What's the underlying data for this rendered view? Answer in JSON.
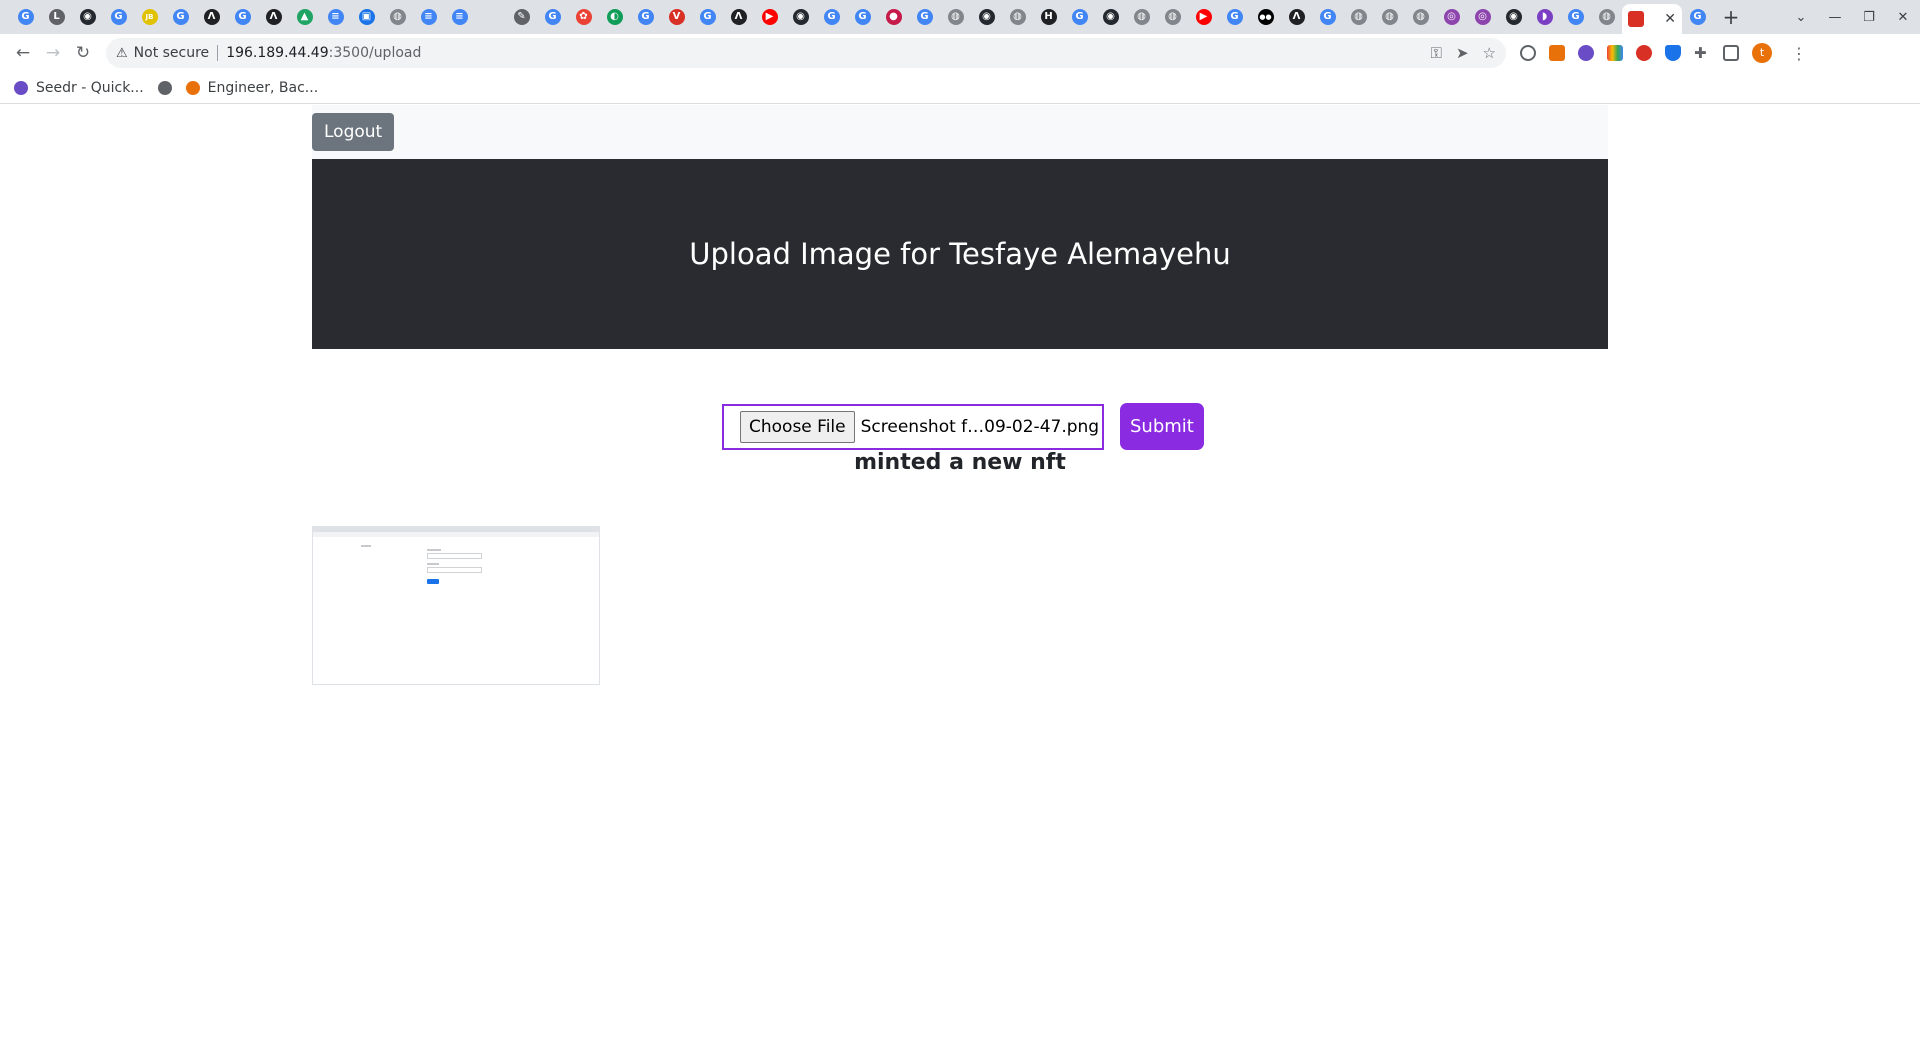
{
  "browser": {
    "url_security": "Not secure",
    "url_host": "196.189.44.49",
    "url_path": ":3500/upload",
    "tab_favicons": [
      {
        "icon": "google-icon",
        "color": "#4285f4",
        "glyph": "G"
      },
      {
        "icon": "letters-icon",
        "color": "#5f6368",
        "glyph": "L"
      },
      {
        "icon": "github-icon",
        "color": "#24292f",
        "glyph": "◉"
      },
      {
        "icon": "google-icon",
        "color": "#4285f4",
        "glyph": "G"
      },
      {
        "icon": "jb-icon",
        "color": "#e0c200",
        "glyph": "JB"
      },
      {
        "icon": "google-icon",
        "color": "#4285f4",
        "glyph": "G"
      },
      {
        "icon": "a-logo-icon",
        "color": "#202124",
        "glyph": "Λ"
      },
      {
        "icon": "google-icon",
        "color": "#4285f4",
        "glyph": "G"
      },
      {
        "icon": "a-logo-icon",
        "color": "#202124",
        "glyph": "Λ"
      },
      {
        "icon": "drive-icon",
        "color": "#1fa463",
        "glyph": "▲"
      },
      {
        "icon": "docs-icon",
        "color": "#4285f4",
        "glyph": "≡"
      },
      {
        "icon": "contacts-icon",
        "color": "#1a73e8",
        "glyph": "▣"
      },
      {
        "icon": "globe-icon",
        "color": "#80868b",
        "glyph": "◍"
      },
      {
        "icon": "docs-icon",
        "color": "#4285f4",
        "glyph": "≡"
      },
      {
        "icon": "docs-icon",
        "color": "#4285f4",
        "glyph": "≡"
      },
      {
        "icon": "blank-icon",
        "color": "#dee1e6",
        "glyph": ""
      },
      {
        "icon": "pen-icon",
        "color": "#5f6368",
        "glyph": "✎"
      },
      {
        "icon": "google-icon",
        "color": "#4285f4",
        "glyph": "G"
      },
      {
        "icon": "colorwheel-icon",
        "color": "#ea4335",
        "glyph": "✿"
      },
      {
        "icon": "edge-icon",
        "color": "#0f9d58",
        "glyph": "◐"
      },
      {
        "icon": "google-icon",
        "color": "#4285f4",
        "glyph": "G"
      },
      {
        "icon": "vivaldi-icon",
        "color": "#d93025",
        "glyph": "V"
      },
      {
        "icon": "google-icon",
        "color": "#4285f4",
        "glyph": "G"
      },
      {
        "icon": "a-logo-icon",
        "color": "#202124",
        "glyph": "Λ"
      },
      {
        "icon": "youtube-icon",
        "color": "#ff0000",
        "glyph": "▶"
      },
      {
        "icon": "github-icon",
        "color": "#24292f",
        "glyph": "◉"
      },
      {
        "icon": "google-icon",
        "color": "#4285f4",
        "glyph": "G"
      },
      {
        "icon": "google-icon",
        "color": "#4285f4",
        "glyph": "G"
      },
      {
        "icon": "raspberry-icon",
        "color": "#c51a4a",
        "glyph": "●"
      },
      {
        "icon": "google-icon",
        "color": "#4285f4",
        "glyph": "G"
      },
      {
        "icon": "globe-icon",
        "color": "#80868b",
        "glyph": "◍"
      },
      {
        "icon": "github-icon",
        "color": "#24292f",
        "glyph": "◉"
      },
      {
        "icon": "globe-icon",
        "color": "#80868b",
        "glyph": "◍"
      },
      {
        "icon": "hashnode-icon",
        "color": "#202124",
        "glyph": "H"
      },
      {
        "icon": "google-icon",
        "color": "#4285f4",
        "glyph": "G"
      },
      {
        "icon": "github-icon",
        "color": "#24292f",
        "glyph": "◉"
      },
      {
        "icon": "globe-icon",
        "color": "#80868b",
        "glyph": "◍"
      },
      {
        "icon": "globe-icon",
        "color": "#80868b",
        "glyph": "◍"
      },
      {
        "icon": "youtube-icon",
        "color": "#ff0000",
        "glyph": "▶"
      },
      {
        "icon": "google-icon",
        "color": "#4285f4",
        "glyph": "G"
      },
      {
        "icon": "medium-icon",
        "color": "#000000",
        "glyph": "●●"
      },
      {
        "icon": "a-logo-icon",
        "color": "#202124",
        "glyph": "Λ"
      },
      {
        "icon": "google-icon",
        "color": "#4285f4",
        "glyph": "G"
      },
      {
        "icon": "globe-icon",
        "color": "#80868b",
        "glyph": "◍"
      },
      {
        "icon": "globe-icon",
        "color": "#80868b",
        "glyph": "◍"
      },
      {
        "icon": "globe-icon",
        "color": "#80868b",
        "glyph": "◍"
      },
      {
        "icon": "ring-icon",
        "color": "#8e44ad",
        "glyph": "◎"
      },
      {
        "icon": "ring-icon",
        "color": "#8e44ad",
        "glyph": "◎"
      },
      {
        "icon": "github-icon",
        "color": "#24292f",
        "glyph": "◉"
      },
      {
        "icon": "firefox-icon",
        "color": "#7b3fc4",
        "glyph": "◗"
      },
      {
        "icon": "google-icon",
        "color": "#4285f4",
        "glyph": "G"
      },
      {
        "icon": "globe-icon",
        "color": "#80868b",
        "glyph": "◍"
      }
    ],
    "active_tab_favicon": {
      "icon": "upload-page-icon",
      "color": "#d93025"
    },
    "after_active_favicon": {
      "icon": "google-icon",
      "color": "#4285f4",
      "glyph": "G"
    },
    "bookmarks": [
      {
        "label": "Seedr - Quick...",
        "icon": "seedr-icon",
        "color": "#6a4cc7"
      },
      {
        "label": "",
        "icon": "globe-icon",
        "color": "#5f6368"
      },
      {
        "label": "Engineer, Bac...",
        "icon": "asterisk-icon",
        "color": "#e8710a"
      }
    ],
    "profile_initial": "t"
  },
  "page": {
    "logout_label": "Logout",
    "hero_title": "Upload Image for Tesfaye Alemayehu",
    "choose_file_label": "Choose File",
    "selected_file_name": "Screenshot f…09-02-47.png",
    "submit_label": "Submit",
    "status_message": "minted a new nft",
    "accent_color": "#8a2be2"
  }
}
